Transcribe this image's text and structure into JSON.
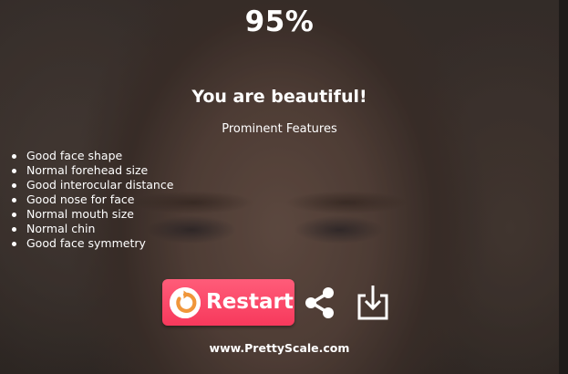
{
  "result": {
    "score_text": "95%",
    "verdict": "You are beautiful!",
    "features_title": "Prominent Features",
    "features": [
      "Good face shape",
      "Normal forehead size",
      "Good interocular distance",
      "Good nose for face",
      "Normal mouth size",
      "Normal chin",
      "Good face symmetry"
    ]
  },
  "actions": {
    "restart_label": "Restart",
    "restart_icon": "restart-icon",
    "share_icon": "share-icon",
    "download_icon": "download-icon"
  },
  "footer": {
    "site": "www.PrettyScale.com"
  },
  "colors": {
    "restart_button": "#f7395c",
    "restart_icon_arrow": "#f0963a",
    "text": "#ffffff"
  }
}
